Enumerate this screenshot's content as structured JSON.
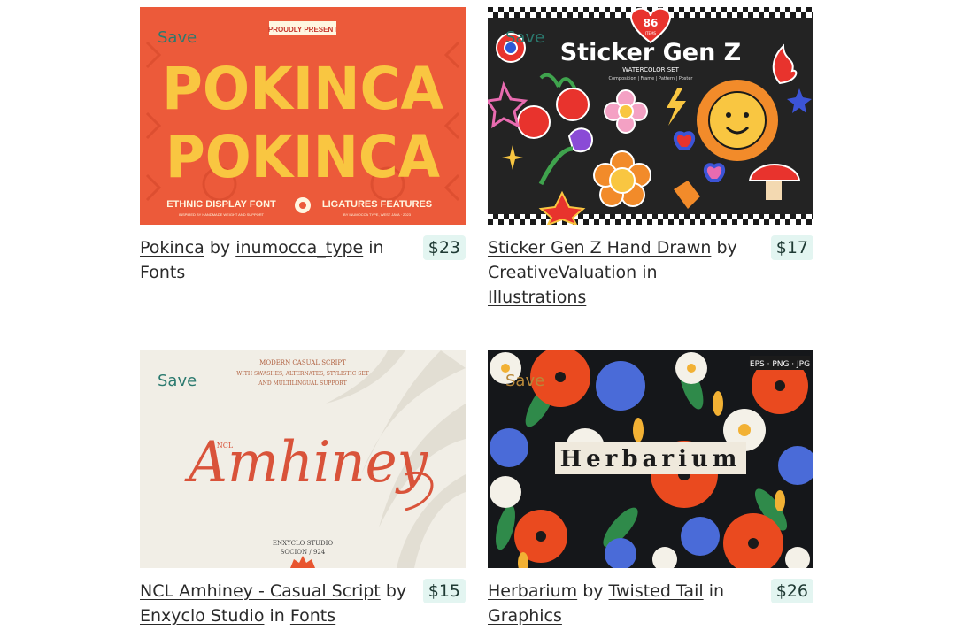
{
  "save_label": "Save",
  "by_label": "by",
  "in_label": "in",
  "products": [
    {
      "title": "Pokinca",
      "author": "inumocca_type",
      "category": "Fonts",
      "price": "$23",
      "art": {
        "badge": "PROUDLY PRESENT",
        "line1": "POKINCA",
        "line2": "POKINCA",
        "left_tag": "ETHNIC DISPLAY FONT",
        "right_tag": "LIGATURES FEATURES",
        "sub_left": "INSPIRED BY HANDMADE WEIGHT AND SUPPORT",
        "sub_right": "BY INUMOCCA TYPE, WEST JAVA · 2023"
      },
      "colors": {
        "bg": "#ec5a3a",
        "text": "#f9c641",
        "save": "#2b7a6f"
      }
    },
    {
      "title": "Sticker Gen Z Hand Drawn",
      "author": "CreativeValuation",
      "category": "Illustrations",
      "price": "$17",
      "art": {
        "count": "86",
        "count_label": "ITEMS",
        "title": "Sticker Gen Z",
        "subtitle": "WATERCOLOR SET",
        "tags": "Composition | Frame | Pattern | Poster"
      },
      "colors": {
        "bg": "#232323",
        "text": "#ffffff",
        "save": "#2b7a6f"
      }
    },
    {
      "title": "NCL Amhiney - Casual Script",
      "author": "Enxyclo Studio",
      "category": "Fonts",
      "price": "$15",
      "art": {
        "top1": "MODERN CASUAL SCRIPT",
        "top2": "WITH SWASHES, ALTERNATES, STYLISTIC SET",
        "top3": "AND MULTILINGUAL SUPPORT",
        "prefix": "NCL",
        "word": "Amhiney",
        "studio1": "ENXYCLO STUDIO",
        "studio2": "SOCION / 924"
      },
      "colors": {
        "bg": "#f1eee6",
        "text": "#d9533a",
        "save": "#2b7a6f"
      }
    },
    {
      "title": "Herbarium",
      "author": "Twisted Tail",
      "category": "Graphics",
      "price": "$26",
      "art": {
        "formats": "EPS · PNG · JPG",
        "word": "Herbarium"
      },
      "colors": {
        "bg": "#15171a",
        "text": "#1b1b1b",
        "save": "#b9893a"
      }
    }
  ]
}
